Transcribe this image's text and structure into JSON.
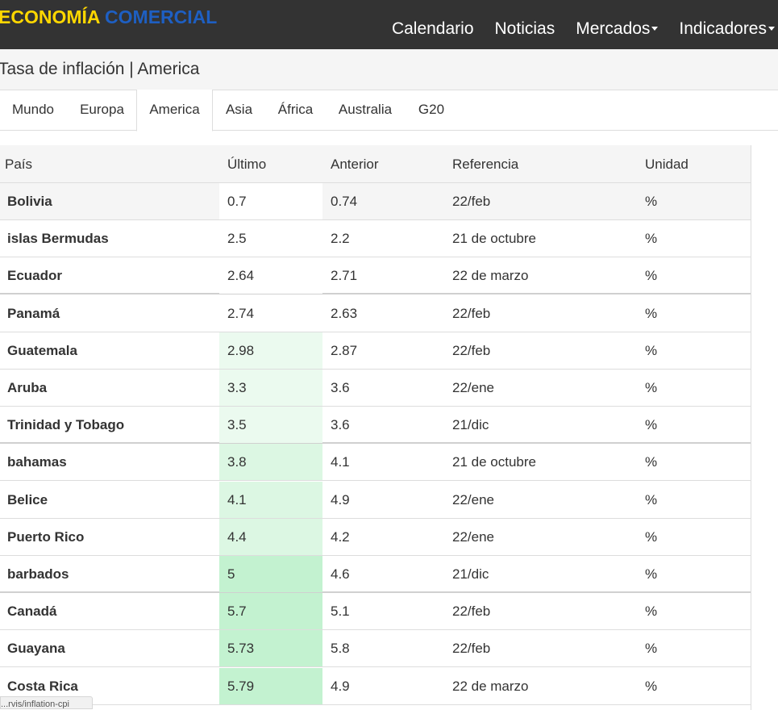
{
  "brand": {
    "part1": "ECONOMÍA",
    "part2": "COMERCIAL",
    "color1": "#ffd700",
    "color2": "#1e5fc2"
  },
  "nav": {
    "items": [
      {
        "label": "Calendario",
        "dropdown": false
      },
      {
        "label": "Noticias",
        "dropdown": false
      },
      {
        "label": "Mercados",
        "dropdown": true
      },
      {
        "label": "Indicadores",
        "dropdown": true
      }
    ]
  },
  "page": {
    "title": "Tasa de inflación | America"
  },
  "tabs": {
    "items": [
      "Mundo",
      "Europa",
      "America",
      "Asia",
      "África",
      "Australia",
      "G20"
    ],
    "active": "America"
  },
  "table": {
    "headers": [
      "País",
      "Último",
      "Anterior",
      "Referencia",
      "Unidad"
    ],
    "rows": [
      {
        "country": "Bolivia",
        "latest": "0.7",
        "previous": "0.74",
        "reference": "22/feb",
        "unit": "%",
        "heat": "#ffffff"
      },
      {
        "country": "islas Bermudas",
        "latest": "2.5",
        "previous": "2.2",
        "reference": "21 de octubre",
        "unit": "%",
        "heat": "#ffffff"
      },
      {
        "country": "Ecuador",
        "latest": "2.64",
        "previous": "2.71",
        "reference": "22 de marzo",
        "unit": "%",
        "heat": "#ffffff"
      },
      {
        "country": "Panamá",
        "latest": "2.74",
        "previous": "2.63",
        "reference": "22/feb",
        "unit": "%",
        "heat": "#ffffff"
      },
      {
        "country": "Guatemala",
        "latest": "2.98",
        "previous": "2.87",
        "reference": "22/feb",
        "unit": "%",
        "heat": "#ebfaef"
      },
      {
        "country": "Aruba",
        "latest": "3.3",
        "previous": "3.6",
        "reference": "22/ene",
        "unit": "%",
        "heat": "#ebfaef"
      },
      {
        "country": "Trinidad y Tobago",
        "latest": "3.5",
        "previous": "3.6",
        "reference": "21/dic",
        "unit": "%",
        "heat": "#ebfaef"
      },
      {
        "country": "bahamas",
        "latest": "3.8",
        "previous": "4.1",
        "reference": "21 de octubre",
        "unit": "%",
        "heat": "#dcf7e3"
      },
      {
        "country": "Belice",
        "latest": "4.1",
        "previous": "4.9",
        "reference": "22/ene",
        "unit": "%",
        "heat": "#dcf7e3"
      },
      {
        "country": "Puerto Rico",
        "latest": "4.4",
        "previous": "4.2",
        "reference": "22/ene",
        "unit": "%",
        "heat": "#dcf7e3"
      },
      {
        "country": "barbados",
        "latest": "5",
        "previous": "4.6",
        "reference": "21/dic",
        "unit": "%",
        "heat": "#c3f2d0"
      },
      {
        "country": "Canadá",
        "latest": "5.7",
        "previous": "5.1",
        "reference": "22/feb",
        "unit": "%",
        "heat": "#c3f2d0"
      },
      {
        "country": "Guayana",
        "latest": "5.73",
        "previous": "5.8",
        "reference": "22/feb",
        "unit": "%",
        "heat": "#c3f2d0"
      },
      {
        "country": "Costa Rica",
        "latest": "5.79",
        "previous": "4.9",
        "reference": "22 de marzo",
        "unit": "%",
        "heat": "#c3f2d0"
      }
    ]
  },
  "status_bar": {
    "text": "...rvis/inflation-cpi"
  }
}
